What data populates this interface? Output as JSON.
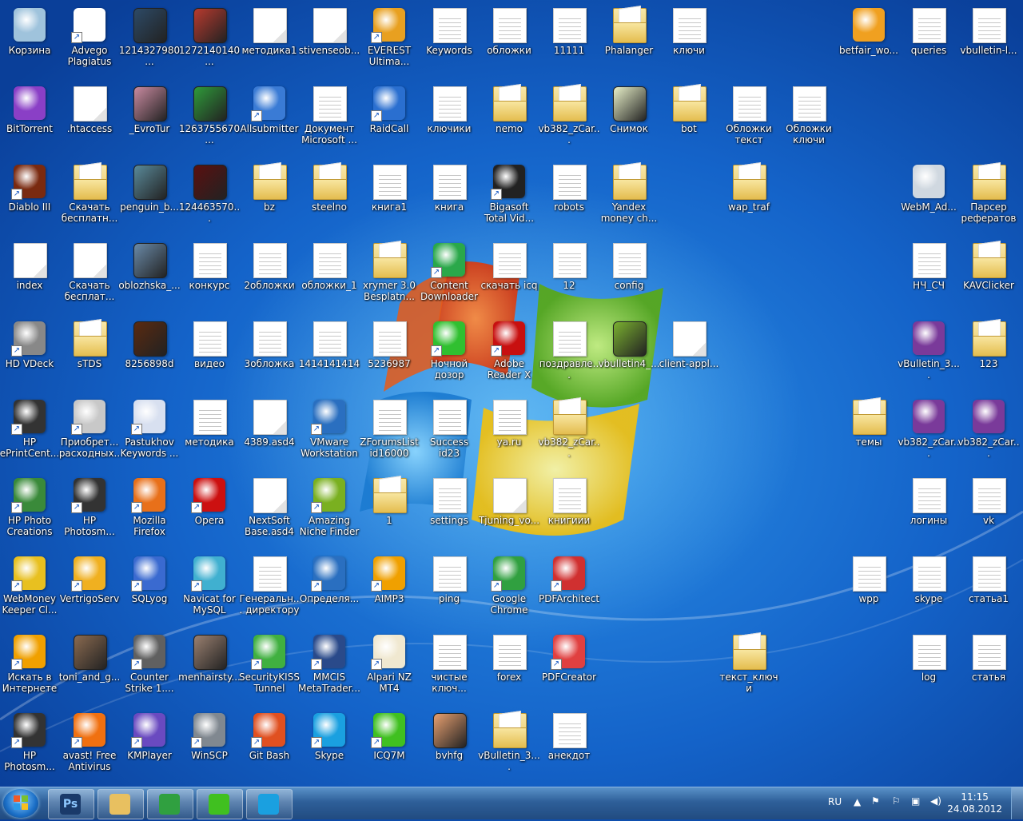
{
  "desktop": {
    "icons": [
      {
        "label": "Корзина",
        "kind": "app",
        "color": "#9fc3dc",
        "shortcut": false,
        "col": 0,
        "row": 0
      },
      {
        "label": "Advego Plagiatus",
        "kind": "app",
        "color": "#ffffff",
        "shortcut": true,
        "col": 1,
        "row": 0
      },
      {
        "label": "1214327980...",
        "kind": "pic",
        "color": "#2d4a66",
        "shortcut": false,
        "col": 2,
        "row": 0
      },
      {
        "label": "1272140140...",
        "kind": "pic",
        "color": "#b83a2e",
        "shortcut": false,
        "col": 3,
        "row": 0
      },
      {
        "label": "методика1",
        "kind": "doc",
        "col": 4,
        "row": 0
      },
      {
        "label": "stivenseob...",
        "kind": "doc",
        "col": 5,
        "row": 0
      },
      {
        "label": "EVEREST Ultima...",
        "kind": "app",
        "color": "#e8a020",
        "shortcut": true,
        "col": 6,
        "row": 0
      },
      {
        "label": "Keywords",
        "kind": "txtdoc",
        "col": 7,
        "row": 0
      },
      {
        "label": "обложки",
        "kind": "txtdoc",
        "col": 8,
        "row": 0
      },
      {
        "label": "11111",
        "kind": "txtdoc",
        "col": 9,
        "row": 0
      },
      {
        "label": "Phalanger",
        "kind": "folder",
        "col": 10,
        "row": 0
      },
      {
        "label": "ключи",
        "kind": "txtdoc",
        "col": 11,
        "row": 0
      },
      {
        "label": "betfair_wo...",
        "kind": "app",
        "color": "#f0a020",
        "shortcut": false,
        "col": 14,
        "row": 0
      },
      {
        "label": "queries",
        "kind": "txtdoc",
        "col": 15,
        "row": 0
      },
      {
        "label": "vbulletin-l...",
        "kind": "txtdoc",
        "col": 16,
        "row": 0
      },
      {
        "label": "BitTorrent",
        "kind": "app",
        "color": "#8a3fc6",
        "shortcut": false,
        "col": 0,
        "row": 1
      },
      {
        "label": ".htaccess",
        "kind": "doc",
        "col": 1,
        "row": 1
      },
      {
        "label": "_EvroTur",
        "kind": "pic",
        "color": "#c98aa0",
        "col": 2,
        "row": 1
      },
      {
        "label": "1263755670...",
        "kind": "pic",
        "color": "#2f9a3a",
        "col": 3,
        "row": 1
      },
      {
        "label": "Allsubmitter",
        "kind": "app",
        "color": "#3a7bd5",
        "shortcut": true,
        "col": 4,
        "row": 1
      },
      {
        "label": "Документ Microsoft ...",
        "kind": "txtdoc",
        "col": 5,
        "row": 1
      },
      {
        "label": "RaidCall",
        "kind": "app",
        "color": "#2a6fd0",
        "shortcut": true,
        "col": 6,
        "row": 1
      },
      {
        "label": "ключики",
        "kind": "txtdoc",
        "col": 7,
        "row": 1
      },
      {
        "label": "nemo",
        "kind": "folder",
        "col": 8,
        "row": 1
      },
      {
        "label": "vb382_zCar...",
        "kind": "folder",
        "col": 9,
        "row": 1
      },
      {
        "label": "Снимок",
        "kind": "pic",
        "color": "#e8f0c8",
        "col": 10,
        "row": 1
      },
      {
        "label": "bot",
        "kind": "folder",
        "col": 11,
        "row": 1
      },
      {
        "label": "Обложки текст",
        "kind": "txtdoc",
        "col": 12,
        "row": 1
      },
      {
        "label": "Обложки ключи",
        "kind": "txtdoc",
        "col": 13,
        "row": 1
      },
      {
        "label": "Diablo III",
        "kind": "app",
        "color": "#7a2a10",
        "shortcut": true,
        "col": 0,
        "row": 2
      },
      {
        "label": "Скачать бесплатн...",
        "kind": "folder",
        "col": 1,
        "row": 2
      },
      {
        "label": "penguin_b...",
        "kind": "pic",
        "color": "#5a8a9a",
        "col": 2,
        "row": 2
      },
      {
        "label": "124463570...",
        "kind": "pic",
        "color": "#5a1010",
        "col": 3,
        "row": 2
      },
      {
        "label": "bz",
        "kind": "folder",
        "col": 4,
        "row": 2
      },
      {
        "label": "steelno",
        "kind": "folder",
        "col": 5,
        "row": 2
      },
      {
        "label": "книга1",
        "kind": "txtdoc",
        "col": 6,
        "row": 2
      },
      {
        "label": "книга",
        "kind": "txtdoc",
        "col": 7,
        "row": 2
      },
      {
        "label": "Bigasoft Total Vid...",
        "kind": "app",
        "color": "#222222",
        "shortcut": true,
        "col": 8,
        "row": 2
      },
      {
        "label": "robots",
        "kind": "txtdoc",
        "col": 9,
        "row": 2
      },
      {
        "label": "Yandex money ch...",
        "kind": "folder",
        "col": 10,
        "row": 2
      },
      {
        "label": "wap_traf",
        "kind": "folder",
        "col": 12,
        "row": 2
      },
      {
        "label": "WebM_Ad...",
        "kind": "app",
        "color": "#d0d8e0",
        "shortcut": false,
        "col": 15,
        "row": 2
      },
      {
        "label": "Парсер рефератов",
        "kind": "folder",
        "col": 16,
        "row": 2
      },
      {
        "label": "index",
        "kind": "doc",
        "col": 0,
        "row": 3
      },
      {
        "label": "Скачать бесплат...",
        "kind": "doc",
        "col": 1,
        "row": 3
      },
      {
        "label": "oblozhska_...",
        "kind": "pic",
        "color": "#6a8aa8",
        "col": 2,
        "row": 3
      },
      {
        "label": "конкурс",
        "kind": "txtdoc",
        "col": 3,
        "row": 3
      },
      {
        "label": "2обложки",
        "kind": "txtdoc",
        "col": 4,
        "row": 3
      },
      {
        "label": "обложки_1",
        "kind": "txtdoc",
        "col": 5,
        "row": 3
      },
      {
        "label": "xrymer 3.0 Besplatn...",
        "kind": "folder",
        "col": 6,
        "row": 3
      },
      {
        "label": "Content Downloader",
        "kind": "app",
        "color": "#2aa84a",
        "shortcut": true,
        "col": 7,
        "row": 3
      },
      {
        "label": "скачать icq",
        "kind": "txtdoc",
        "col": 8,
        "row": 3
      },
      {
        "label": "12",
        "kind": "txtdoc",
        "col": 9,
        "row": 3
      },
      {
        "label": "config",
        "kind": "txtdoc",
        "col": 10,
        "row": 3
      },
      {
        "label": "НЧ_СЧ",
        "kind": "txtdoc",
        "col": 15,
        "row": 3
      },
      {
        "label": "KAVClicker",
        "kind": "folder",
        "col": 16,
        "row": 3
      },
      {
        "label": "HD VDeck",
        "kind": "app",
        "color": "#888888",
        "shortcut": true,
        "col": 0,
        "row": 4
      },
      {
        "label": "sTDS",
        "kind": "folder",
        "col": 1,
        "row": 4
      },
      {
        "label": "8256898d",
        "kind": "pic",
        "color": "#5a2a10",
        "col": 2,
        "row": 4
      },
      {
        "label": "видео",
        "kind": "txtdoc",
        "col": 3,
        "row": 4
      },
      {
        "label": "3обложка",
        "kind": "txtdoc",
        "col": 4,
        "row": 4
      },
      {
        "label": "1414141414",
        "kind": "txtdoc",
        "col": 5,
        "row": 4
      },
      {
        "label": "5236987",
        "kind": "txtdoc",
        "col": 6,
        "row": 4
      },
      {
        "label": "Ночной дозор",
        "kind": "app",
        "color": "#30c030",
        "shortcut": true,
        "col": 7,
        "row": 4
      },
      {
        "label": "Adobe Reader X",
        "kind": "app",
        "color": "#c81010",
        "shortcut": true,
        "col": 8,
        "row": 4
      },
      {
        "label": "поздравле...",
        "kind": "txtdoc",
        "col": 9,
        "row": 4
      },
      {
        "label": "vbulletin4_...",
        "kind": "pic",
        "color": "#7ab030",
        "col": 10,
        "row": 4
      },
      {
        "label": "client-appl...",
        "kind": "doc",
        "col": 11,
        "row": 4
      },
      {
        "label": "vBulletin_3....",
        "kind": "app",
        "color": "#7a3a9a",
        "shortcut": false,
        "col": 15,
        "row": 4
      },
      {
        "label": "123",
        "kind": "folder",
        "col": 16,
        "row": 4
      },
      {
        "label": "HP ePrintCent...",
        "kind": "app",
        "color": "#333333",
        "shortcut": true,
        "col": 0,
        "row": 5
      },
      {
        "label": "Приобрет... расходных...",
        "kind": "app",
        "color": "#c8c8c8",
        "shortcut": true,
        "col": 1,
        "row": 5
      },
      {
        "label": "Pastukhov Keywords ...",
        "kind": "app",
        "color": "#d8e0f0",
        "shortcut": true,
        "col": 2,
        "row": 5
      },
      {
        "label": "методика",
        "kind": "txtdoc",
        "col": 3,
        "row": 5
      },
      {
        "label": "4389.asd4",
        "kind": "doc",
        "col": 4,
        "row": 5
      },
      {
        "label": "VMware Workstation",
        "kind": "app",
        "color": "#2a6fc0",
        "shortcut": true,
        "col": 5,
        "row": 5
      },
      {
        "label": "ZForumsList id16000",
        "kind": "txtdoc",
        "col": 6,
        "row": 5
      },
      {
        "label": "Success id23",
        "kind": "txtdoc",
        "col": 7,
        "row": 5
      },
      {
        "label": "ya.ru",
        "kind": "txtdoc",
        "col": 8,
        "row": 5
      },
      {
        "label": "vb382_zCar...",
        "kind": "folder",
        "col": 9,
        "row": 5
      },
      {
        "label": "темы",
        "kind": "folder",
        "col": 14,
        "row": 5
      },
      {
        "label": "vb382_zCar...",
        "kind": "app",
        "color": "#7a3a9a",
        "shortcut": false,
        "col": 15,
        "row": 5
      },
      {
        "label": "vb382_zCar...",
        "kind": "app",
        "color": "#7a3a9a",
        "shortcut": false,
        "col": 16,
        "row": 5
      },
      {
        "label": "HP Photo Creations",
        "kind": "app",
        "color": "#3a8a3a",
        "shortcut": true,
        "col": 0,
        "row": 6
      },
      {
        "label": "HP Photosm...",
        "kind": "app",
        "color": "#333333",
        "shortcut": true,
        "col": 1,
        "row": 6
      },
      {
        "label": "Mozilla Firefox",
        "kind": "app",
        "color": "#e8701a",
        "shortcut": true,
        "col": 2,
        "row": 6
      },
      {
        "label": "Opera",
        "kind": "app",
        "color": "#cc1010",
        "shortcut": true,
        "col": 3,
        "row": 6
      },
      {
        "label": "NextSoft Base.asd4",
        "kind": "doc",
        "col": 4,
        "row": 6
      },
      {
        "label": "Amazing Niche Finder",
        "kind": "app",
        "color": "#7ab020",
        "shortcut": true,
        "col": 5,
        "row": 6
      },
      {
        "label": "1",
        "kind": "folder",
        "col": 6,
        "row": 6
      },
      {
        "label": "settings",
        "kind": "txtdoc",
        "col": 7,
        "row": 6
      },
      {
        "label": "Tjuning_vo...",
        "kind": "doc",
        "col": 8,
        "row": 6
      },
      {
        "label": "книгиии",
        "kind": "txtdoc",
        "col": 9,
        "row": 6
      },
      {
        "label": "логины",
        "kind": "txtdoc",
        "col": 15,
        "row": 6
      },
      {
        "label": "vk",
        "kind": "txtdoc",
        "col": 16,
        "row": 6
      },
      {
        "label": "WebMoney Keeper Cl...",
        "kind": "app",
        "color": "#e8c020",
        "shortcut": true,
        "col": 0,
        "row": 7
      },
      {
        "label": "VertrigoServ",
        "kind": "app",
        "color": "#f0b020",
        "shortcut": true,
        "col": 1,
        "row": 7
      },
      {
        "label": "SQLyog",
        "kind": "app",
        "color": "#3a6ad0",
        "shortcut": true,
        "col": 2,
        "row": 7
      },
      {
        "label": "Navicat for MySQL",
        "kind": "app",
        "color": "#40b0d0",
        "shortcut": true,
        "col": 3,
        "row": 7
      },
      {
        "label": "Генеральн... директору",
        "kind": "txtdoc",
        "col": 4,
        "row": 7
      },
      {
        "label": "Определя...",
        "kind": "app",
        "color": "#2a6fc0",
        "shortcut": true,
        "col": 5,
        "row": 7
      },
      {
        "label": "AIMP3",
        "kind": "app",
        "color": "#f0a000",
        "shortcut": true,
        "col": 6,
        "row": 7
      },
      {
        "label": "ping",
        "kind": "txtdoc",
        "col": 7,
        "row": 7
      },
      {
        "label": "Google Chrome",
        "kind": "app",
        "color": "#30a040",
        "shortcut": true,
        "col": 8,
        "row": 7
      },
      {
        "label": "PDFArchitect",
        "kind": "app",
        "color": "#d03030",
        "shortcut": true,
        "col": 9,
        "row": 7
      },
      {
        "label": "wpp",
        "kind": "txtdoc",
        "col": 14,
        "row": 7
      },
      {
        "label": "skype",
        "kind": "txtdoc",
        "col": 15,
        "row": 7
      },
      {
        "label": "статьа1",
        "kind": "txtdoc",
        "col": 16,
        "row": 7
      },
      {
        "label": "Искать в Интернете",
        "kind": "app",
        "color": "#f0a000",
        "shortcut": true,
        "col": 0,
        "row": 8
      },
      {
        "label": "toni_and_g...",
        "kind": "pic",
        "color": "#8a6a50",
        "col": 1,
        "row": 8
      },
      {
        "label": "Counter Strike 1....",
        "kind": "app",
        "color": "#606060",
        "shortcut": true,
        "col": 2,
        "row": 8
      },
      {
        "label": "menhairsty...",
        "kind": "pic",
        "color": "#9a8070",
        "col": 3,
        "row": 8
      },
      {
        "label": "SecurityKISS Tunnel",
        "kind": "app",
        "color": "#40b040",
        "shortcut": true,
        "col": 4,
        "row": 8
      },
      {
        "label": "MMCIS MetaTrader...",
        "kind": "app",
        "color": "#2a4a8a",
        "shortcut": true,
        "col": 5,
        "row": 8
      },
      {
        "label": "Alpari NZ MT4",
        "kind": "app",
        "color": "#f0e8d0",
        "shortcut": true,
        "col": 6,
        "row": 8
      },
      {
        "label": "чистые ключ...",
        "kind": "txtdoc",
        "col": 7,
        "row": 8
      },
      {
        "label": "forex",
        "kind": "txtdoc",
        "col": 8,
        "row": 8
      },
      {
        "label": "PDFCreator",
        "kind": "app",
        "color": "#e04040",
        "shortcut": true,
        "col": 9,
        "row": 8
      },
      {
        "label": "текст_ключи",
        "kind": "folder",
        "col": 12,
        "row": 8
      },
      {
        "label": "log",
        "kind": "txtdoc",
        "col": 15,
        "row": 8
      },
      {
        "label": "статья",
        "kind": "txtdoc",
        "col": 16,
        "row": 8
      },
      {
        "label": "HP Photosm...",
        "kind": "app",
        "color": "#333333",
        "shortcut": true,
        "col": 0,
        "row": 9
      },
      {
        "label": "avast! Free Antivirus",
        "kind": "app",
        "color": "#f07010",
        "shortcut": true,
        "col": 1,
        "row": 9
      },
      {
        "label": "KMPlayer",
        "kind": "app",
        "color": "#6a4ac0",
        "shortcut": true,
        "col": 2,
        "row": 9
      },
      {
        "label": "WinSCP",
        "kind": "app",
        "color": "#808890",
        "shortcut": true,
        "col": 3,
        "row": 9
      },
      {
        "label": "Git Bash",
        "kind": "app",
        "color": "#e05020",
        "shortcut": true,
        "col": 4,
        "row": 9
      },
      {
        "label": "Skype",
        "kind": "app",
        "color": "#1aa0e0",
        "shortcut": true,
        "col": 5,
        "row": 9
      },
      {
        "label": "ICQ7M",
        "kind": "app",
        "color": "#40c020",
        "shortcut": true,
        "col": 6,
        "row": 9
      },
      {
        "label": "bvhfg",
        "kind": "pic",
        "color": "#e8a070",
        "col": 7,
        "row": 9
      },
      {
        "label": "vBulletin_3....",
        "kind": "folder",
        "col": 8,
        "row": 9
      },
      {
        "label": "анекдот",
        "kind": "txtdoc",
        "col": 9,
        "row": 9
      }
    ]
  },
  "taskbar": {
    "start_label": "Пуск",
    "pinned": [
      {
        "name": "photoshop",
        "text": "Ps",
        "color": "#1a3a6a"
      },
      {
        "name": "explorer",
        "text": "",
        "color": "#e8c060"
      },
      {
        "name": "chrome",
        "text": "",
        "color": "#30a040"
      },
      {
        "name": "icq",
        "text": "",
        "color": "#40c020"
      },
      {
        "name": "skype",
        "text": "",
        "color": "#1aa0e0"
      }
    ],
    "language": "RU",
    "time": "11:15",
    "date": "24.08.2012"
  }
}
